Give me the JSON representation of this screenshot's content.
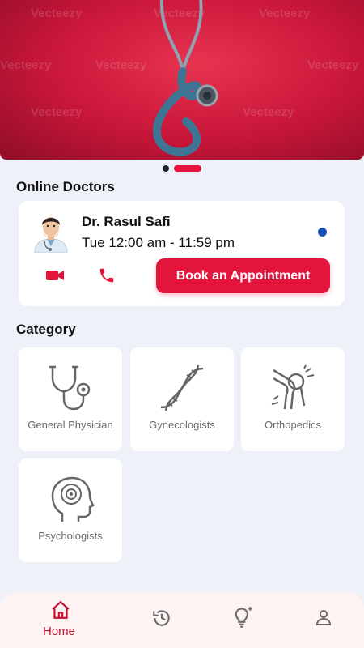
{
  "banner": {
    "watermark": "Vecteezy",
    "carousel": {
      "count": 2,
      "active_index": 1
    }
  },
  "online_doctors": {
    "title": "Online Doctors",
    "doctor": {
      "name": "Dr. Rasul Safi",
      "availability": "Tue 12:00 am - 11:59 pm",
      "status_color": "#1650b8"
    },
    "actions": {
      "video_icon": "video-camera-icon",
      "call_icon": "phone-icon",
      "book_label": "Book an Appointment"
    }
  },
  "category": {
    "title": "Category",
    "items": [
      {
        "label": "General Physician",
        "icon": "stethoscope-icon"
      },
      {
        "label": "Gynecologists",
        "icon": "dna-icon"
      },
      {
        "label": "Orthopedics",
        "icon": "knee-joint-icon"
      },
      {
        "label": "Psychologists",
        "icon": "brain-head-icon"
      }
    ]
  },
  "bottom_nav": {
    "items": [
      {
        "label": "Home",
        "icon": "home-icon",
        "active": true
      },
      {
        "label": "",
        "icon": "history-icon",
        "active": false
      },
      {
        "label": "",
        "icon": "lightbulb-icon",
        "active": false
      },
      {
        "label": "",
        "icon": "profile-icon",
        "active": false
      }
    ]
  },
  "colors": {
    "accent": "#e4153d",
    "background": "#eef1f8",
    "nav_background": "#fdf3f3",
    "active_nav": "#c8102e"
  }
}
